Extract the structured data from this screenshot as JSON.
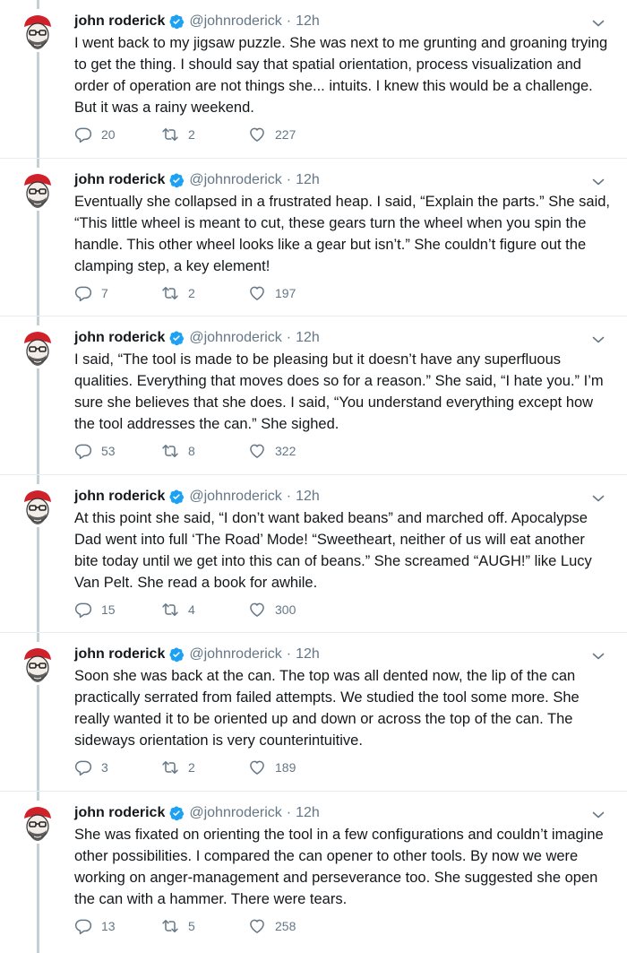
{
  "tweets": [
    {
      "name": "john roderick",
      "handle": "@johnroderick",
      "separator": "·",
      "time": "12h",
      "text": "I went back to my jigsaw puzzle. She was next to me grunting and groaning trying to get the thing. I should say that spatial orientation, process visualization and order of operation are not things she... intuits. I knew this would be a challenge. But it was a rainy weekend.",
      "replies": "20",
      "retweets": "2",
      "likes": "227"
    },
    {
      "name": "john roderick",
      "handle": "@johnroderick",
      "separator": "·",
      "time": "12h",
      "text": "Eventually she collapsed in a frustrated heap. I said, “Explain the parts.” She said, “This little wheel is meant to cut, these gears turn the wheel when you spin the handle. This other wheel looks like a gear but isn’t.” She couldn’t figure out the clamping step, a key element!",
      "replies": "7",
      "retweets": "2",
      "likes": "197"
    },
    {
      "name": "john roderick",
      "handle": "@johnroderick",
      "separator": "·",
      "time": "12h",
      "text": "I said, “The tool is made to be pleasing but it doesn’t have any superfluous qualities. Everything that moves does so for a reason.” She said, “I hate you.” I’m sure she believes that she does. I said, “You understand everything except how the tool addresses the can.” She sighed.",
      "replies": "53",
      "retweets": "8",
      "likes": "322"
    },
    {
      "name": "john roderick",
      "handle": "@johnroderick",
      "separator": "·",
      "time": "12h",
      "text": "At this point she said, “I don’t want baked beans” and marched off. Apocalypse Dad went into full ‘The Road’ Mode! “Sweetheart, neither of us will eat another bite today until we get into this can of beans.” She screamed “AUGH!” like Lucy Van Pelt. She read a book for awhile.",
      "replies": "15",
      "retweets": "4",
      "likes": "300"
    },
    {
      "name": "john roderick",
      "handle": "@johnroderick",
      "separator": "·",
      "time": "12h",
      "text": "Soon she was back at the can. The top was all dented now, the lip of the can practically serrated from failed attempts. We studied the tool some more. She really wanted it to be oriented up and down or across the top of the can. The sideways orientation is very counterintuitive.",
      "replies": "3",
      "retweets": "2",
      "likes": "189"
    },
    {
      "name": "john roderick",
      "handle": "@johnroderick",
      "separator": "·",
      "time": "12h",
      "text": "She was fixated on orienting the tool in a few configurations and couldn’t imagine other possibilities. I compared the can opener to other tools. By now we were working on anger-management and perseverance too. She suggested she open the can with a hammer. There were tears.",
      "replies": "13",
      "retweets": "5",
      "likes": "258"
    }
  ],
  "icons": {
    "verified": "verified-badge-icon",
    "more": "chevron-down-icon",
    "reply": "reply-icon",
    "retweet": "retweet-icon",
    "like": "heart-icon"
  },
  "colors": {
    "accent": "#1da1f2",
    "secondary_text": "#657786",
    "thread_line": "#c4cfd6",
    "avatar_hat": "#d0212b"
  }
}
